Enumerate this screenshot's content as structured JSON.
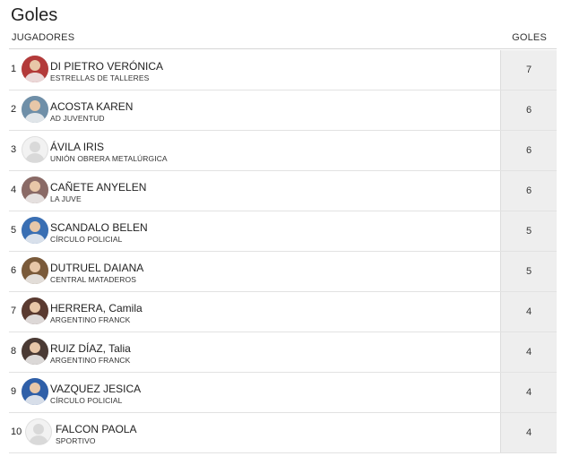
{
  "title": "Goles",
  "columns": {
    "player": "JUGADORES",
    "goals": "GOLES"
  },
  "rows": [
    {
      "rank": "1",
      "name": "DI PIETRO VERÓNICA",
      "team": "ESTRELLAS DE TALLERES",
      "goals": "7",
      "avatar": "photo",
      "color": "#b33a3a"
    },
    {
      "rank": "2",
      "name": "ACOSTA KAREN",
      "team": "AD JUVENTUD",
      "goals": "6",
      "avatar": "photo",
      "color": "#6f8fa8"
    },
    {
      "rank": "3",
      "name": "ÁVILA IRIS",
      "team": "UNIÓN OBRERA METALÚRGICA",
      "goals": "6",
      "avatar": "placeholder",
      "color": "#dddddd"
    },
    {
      "rank": "4",
      "name": "CAÑETE ANYELEN",
      "team": "LA JUVE",
      "goals": "6",
      "avatar": "photo",
      "color": "#8a6a66"
    },
    {
      "rank": "5",
      "name": "SCANDALO BELEN",
      "team": "CÍRCULO POLICIAL",
      "goals": "5",
      "avatar": "photo",
      "color": "#3a6fb3"
    },
    {
      "rank": "6",
      "name": "DUTRUEL DAIANA",
      "team": "CENTRAL MATADEROS",
      "goals": "5",
      "avatar": "photo",
      "color": "#7a5a3a"
    },
    {
      "rank": "7",
      "name": "HERRERA, Camila",
      "team": "ARGENTINO FRANCK",
      "goals": "4",
      "avatar": "photo",
      "color": "#5a3a30"
    },
    {
      "rank": "8",
      "name": "RUIZ DÍAZ, Talia",
      "team": "ARGENTINO FRANCK",
      "goals": "4",
      "avatar": "photo",
      "color": "#4a3a34"
    },
    {
      "rank": "9",
      "name": "VAZQUEZ JESICA",
      "team": "CÍRCULO POLICIAL",
      "goals": "4",
      "avatar": "photo",
      "color": "#2f5fa8"
    },
    {
      "rank": "10",
      "name": "FALCON PAOLA",
      "team": "SPORTIVO",
      "goals": "4",
      "avatar": "placeholder",
      "color": "#dddddd"
    }
  ]
}
